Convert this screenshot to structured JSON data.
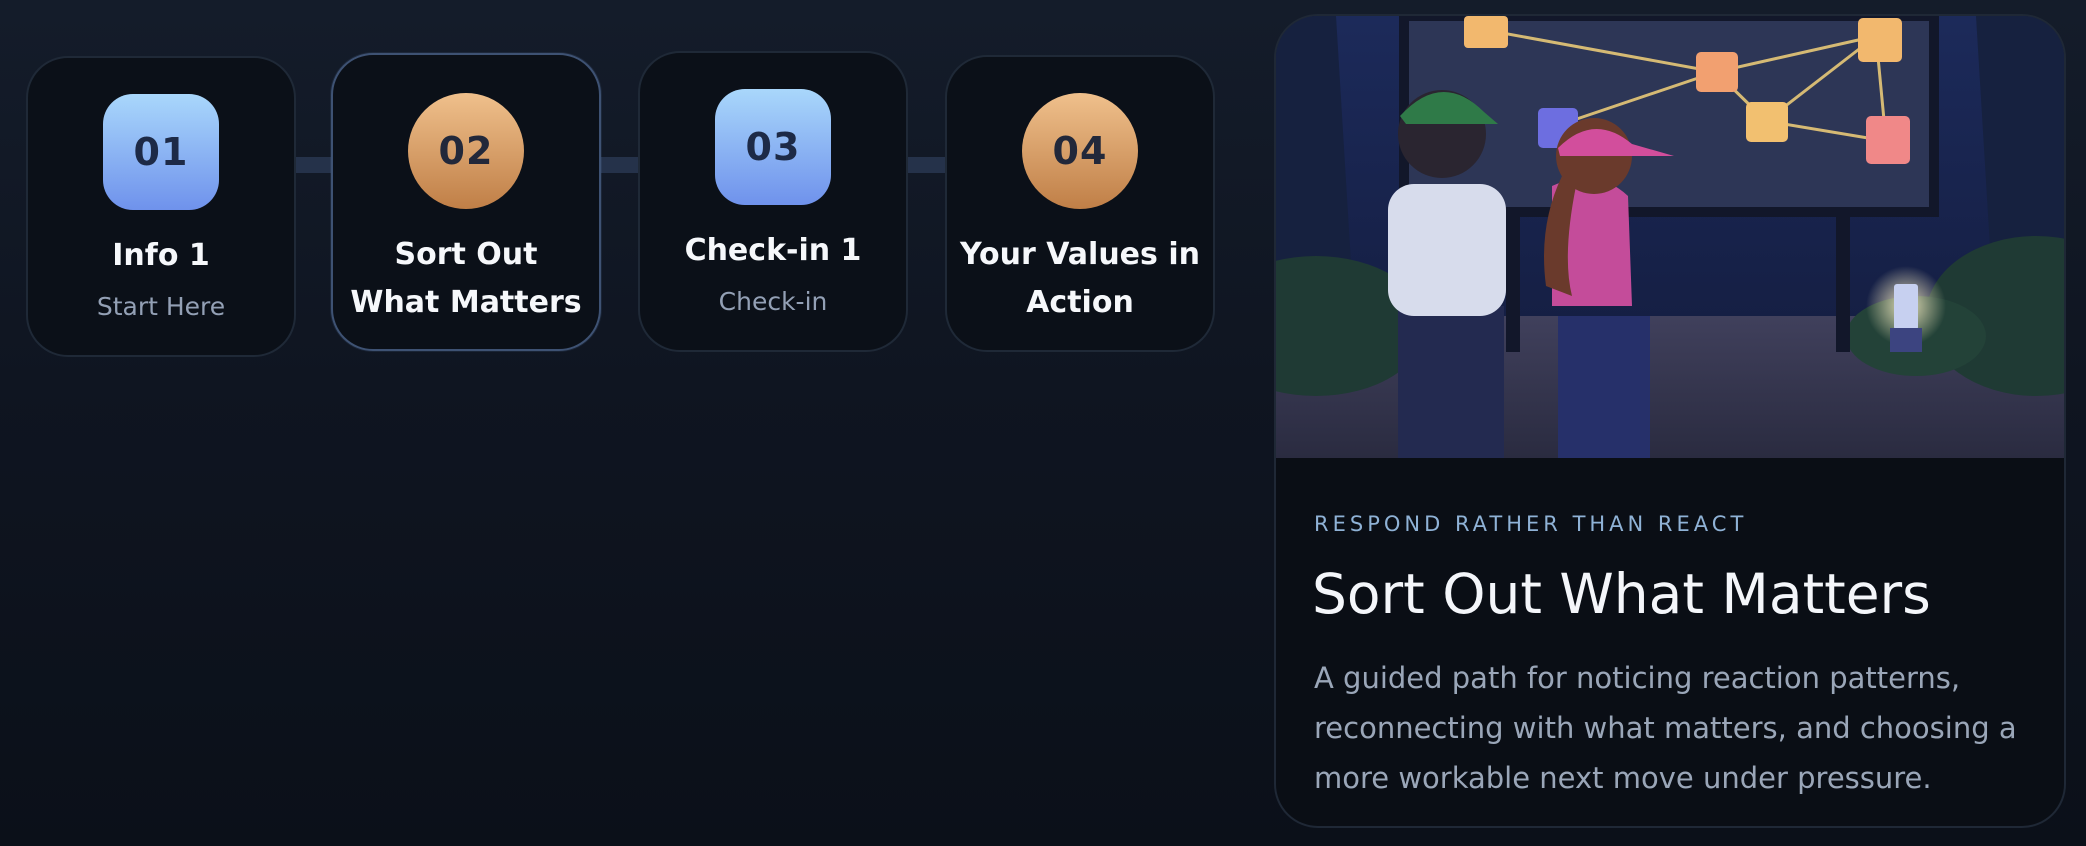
{
  "steps": [
    {
      "number": "01",
      "title": "Info 1",
      "subtitle": "Start Here"
    },
    {
      "number": "02",
      "title": "Sort Out What Matters",
      "subtitle": ""
    },
    {
      "number": "03",
      "title": "Check-in 1",
      "subtitle": "Check-in"
    },
    {
      "number": "04",
      "title": "Your Values in Action",
      "subtitle": ""
    }
  ],
  "card": {
    "eyebrow": "RESPOND RATHER THAN REACT",
    "title": "Sort Out What Matters",
    "description": "A guided path for noticing reaction patterns, reconnecting with what matters, and choosing a more workable next move under pressure."
  },
  "colors": {
    "background": "#0f1521",
    "card_background": "#0a0e15",
    "badge_blue": "#8fb6f3",
    "badge_orange": "#d99a62",
    "eyebrow": "#8fb2d6",
    "muted_text": "#9aa6b8"
  }
}
